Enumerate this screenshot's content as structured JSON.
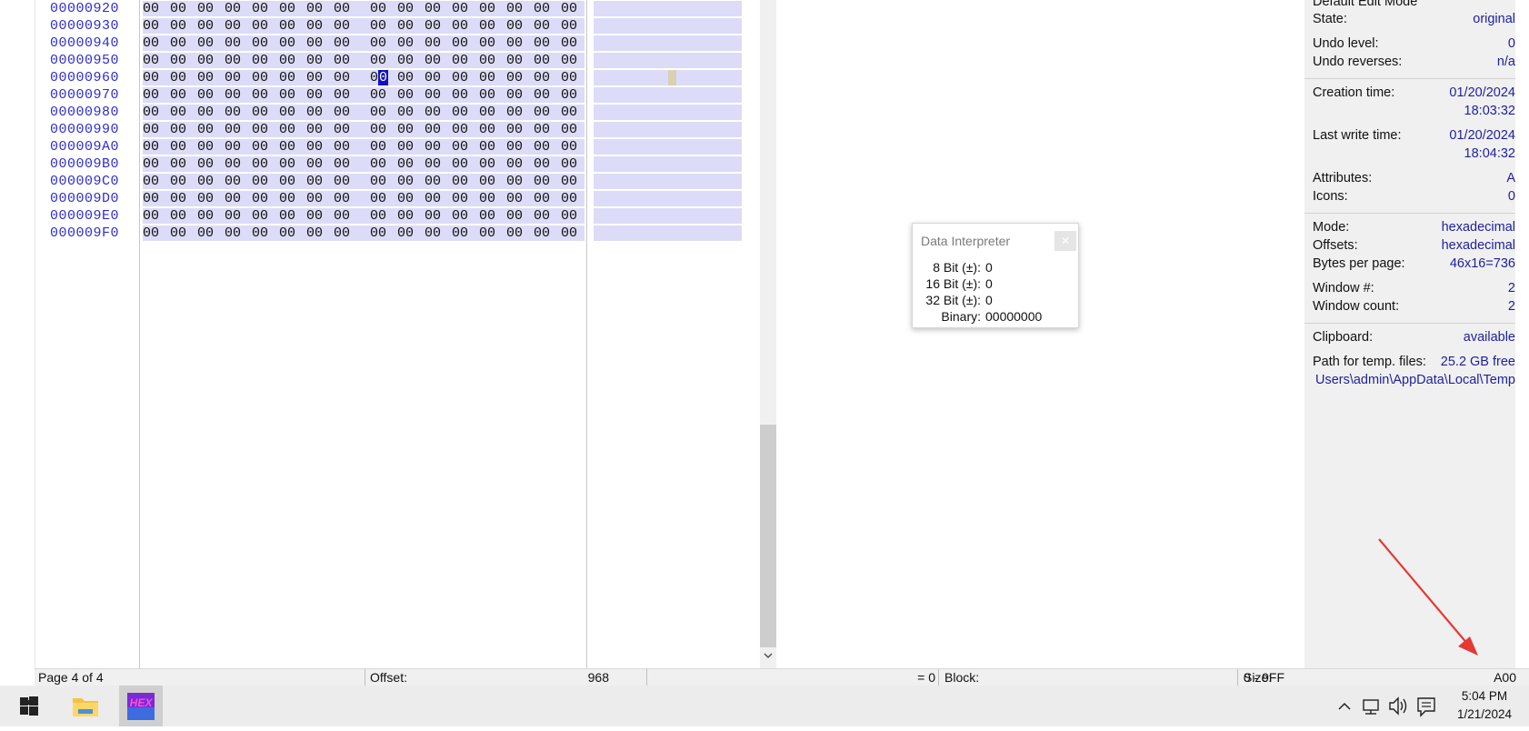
{
  "hex_view": {
    "rows": [
      {
        "offset": "00000920",
        "left": [
          "00",
          "00",
          "00",
          "00",
          "00",
          "00",
          "00",
          "00"
        ],
        "right": [
          "00",
          "00",
          "00",
          "00",
          "00",
          "00",
          "00",
          "00"
        ]
      },
      {
        "offset": "00000930",
        "left": [
          "00",
          "00",
          "00",
          "00",
          "00",
          "00",
          "00",
          "00"
        ],
        "right": [
          "00",
          "00",
          "00",
          "00",
          "00",
          "00",
          "00",
          "00"
        ]
      },
      {
        "offset": "00000940",
        "left": [
          "00",
          "00",
          "00",
          "00",
          "00",
          "00",
          "00",
          "00"
        ],
        "right": [
          "00",
          "00",
          "00",
          "00",
          "00",
          "00",
          "00",
          "00"
        ]
      },
      {
        "offset": "00000950",
        "left": [
          "00",
          "00",
          "00",
          "00",
          "00",
          "00",
          "00",
          "00"
        ],
        "right": [
          "00",
          "00",
          "00",
          "00",
          "00",
          "00",
          "00",
          "00"
        ]
      },
      {
        "offset": "00000960",
        "left": [
          "00",
          "00",
          "00",
          "00",
          "00",
          "00",
          "00",
          "00"
        ],
        "right": [
          "00",
          "00",
          "00",
          "00",
          "00",
          "00",
          "00",
          "00"
        ]
      },
      {
        "offset": "00000970",
        "left": [
          "00",
          "00",
          "00",
          "00",
          "00",
          "00",
          "00",
          "00"
        ],
        "right": [
          "00",
          "00",
          "00",
          "00",
          "00",
          "00",
          "00",
          "00"
        ]
      },
      {
        "offset": "00000980",
        "left": [
          "00",
          "00",
          "00",
          "00",
          "00",
          "00",
          "00",
          "00"
        ],
        "right": [
          "00",
          "00",
          "00",
          "00",
          "00",
          "00",
          "00",
          "00"
        ]
      },
      {
        "offset": "00000990",
        "left": [
          "00",
          "00",
          "00",
          "00",
          "00",
          "00",
          "00",
          "00"
        ],
        "right": [
          "00",
          "00",
          "00",
          "00",
          "00",
          "00",
          "00",
          "00"
        ]
      },
      {
        "offset": "000009A0",
        "left": [
          "00",
          "00",
          "00",
          "00",
          "00",
          "00",
          "00",
          "00"
        ],
        "right": [
          "00",
          "00",
          "00",
          "00",
          "00",
          "00",
          "00",
          "00"
        ]
      },
      {
        "offset": "000009B0",
        "left": [
          "00",
          "00",
          "00",
          "00",
          "00",
          "00",
          "00",
          "00"
        ],
        "right": [
          "00",
          "00",
          "00",
          "00",
          "00",
          "00",
          "00",
          "00"
        ]
      },
      {
        "offset": "000009C0",
        "left": [
          "00",
          "00",
          "00",
          "00",
          "00",
          "00",
          "00",
          "00"
        ],
        "right": [
          "00",
          "00",
          "00",
          "00",
          "00",
          "00",
          "00",
          "00"
        ]
      },
      {
        "offset": "000009D0",
        "left": [
          "00",
          "00",
          "00",
          "00",
          "00",
          "00",
          "00",
          "00"
        ],
        "right": [
          "00",
          "00",
          "00",
          "00",
          "00",
          "00",
          "00",
          "00"
        ]
      },
      {
        "offset": "000009E0",
        "left": [
          "00",
          "00",
          "00",
          "00",
          "00",
          "00",
          "00",
          "00"
        ],
        "right": [
          "00",
          "00",
          "00",
          "00",
          "00",
          "00",
          "00",
          "00"
        ]
      },
      {
        "offset": "000009F0",
        "left": [
          "00",
          "00",
          "00",
          "00",
          "00",
          "00",
          "00",
          "00"
        ],
        "right": [
          "00",
          "00",
          "00",
          "00",
          "00",
          "00",
          "00",
          "00"
        ]
      }
    ],
    "cursor": {
      "row_offset": "00000960",
      "byte_in_row": 8,
      "digit": "0"
    },
    "selection_color": "#dcdcf8",
    "cursor_color": "#1010c0"
  },
  "data_interpreter": {
    "title": "Data Interpreter",
    "close_icon": "close-icon",
    "rows": [
      {
        "label": "8 Bit (±):",
        "value": "0"
      },
      {
        "label": "16 Bit (±):",
        "value": "0"
      },
      {
        "label": "32 Bit (±):",
        "value": "0"
      },
      {
        "label": "Binary:",
        "value": "00000000"
      }
    ]
  },
  "info_panel": {
    "mode_title": "Default Edit Mode",
    "state_label": "State:",
    "state_value": "original",
    "undo_level_label": "Undo level:",
    "undo_level_value": "0",
    "undo_reverses_label": "Undo reverses:",
    "undo_reverses_value": "n/a",
    "creation_label": "Creation time:",
    "creation_date": "01/20/2024",
    "creation_time": "18:03:32",
    "last_write_label": "Last write time:",
    "last_write_date": "01/20/2024",
    "last_write_time": "18:04:32",
    "attributes_label": "Attributes:",
    "attributes_value": "A",
    "icons_label": "Icons:",
    "icons_value": "0",
    "mode_label": "Mode:",
    "mode_value": "hexadecimal",
    "offsets_label": "Offsets:",
    "offsets_value": "hexadecimal",
    "bytes_per_page_label": "Bytes per page:",
    "bytes_per_page_value": "46x16=736",
    "window_num_label": "Window #:",
    "window_num_value": "2",
    "window_count_label": "Window count:",
    "window_count_value": "2",
    "clipboard_label": "Clipboard:",
    "clipboard_value": "available",
    "temp_label": "Path for temp. files:",
    "temp_free": "25.2 GB free",
    "temp_path": "Users\\admin\\AppData\\Local\\Temp"
  },
  "status_bar": {
    "page": "Page 4 of 4",
    "offset_label": "Offset:",
    "offset_value": "968",
    "equals_value": "= 0",
    "block_label": "Block:",
    "block_value": "0 - 9FF",
    "size_label": "Size:",
    "size_value": "A00"
  },
  "taskbar": {
    "start_icon": "windows-start-icon",
    "explorer_icon": "file-explorer-icon",
    "hex_app_icon": "hex-editor-icon",
    "hex_app_label": "HEX",
    "tray_chevron": "chevron-up-icon",
    "network_icon": "network-icon",
    "volume_icon": "volume-icon",
    "notification_icon": "notification-icon",
    "time": "5:04 PM",
    "date": "1/21/2024"
  },
  "annotation": {
    "arrow_color": "#e53935"
  }
}
